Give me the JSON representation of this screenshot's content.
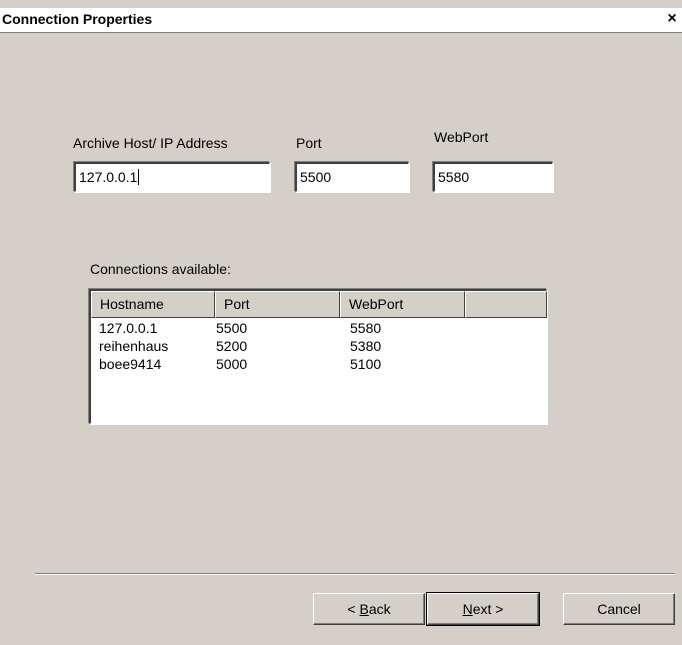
{
  "window": {
    "title": "Connection Properties",
    "close_glyph": "×",
    "close_icon": "close-icon"
  },
  "fields": {
    "host_label": "Archive Host/ IP Address",
    "host_value": "127.0.0.1",
    "port_label": "Port",
    "port_value": "5500",
    "webport_label": "WebPort",
    "webport_value": "5580"
  },
  "connections": {
    "label": "Connections available:",
    "columns": [
      "Hostname",
      "Port",
      "WebPort",
      ""
    ],
    "rows": [
      [
        "127.0.0.1",
        "5500",
        "5580"
      ],
      [
        "reihenhaus",
        "5200",
        "5380"
      ],
      [
        "boee9414",
        "5000",
        "5100"
      ]
    ]
  },
  "buttons": {
    "back_prefix": "< ",
    "back_mnemonic": "B",
    "back_rest": "ack",
    "next_mnemonic": "N",
    "next_rest": "ext >",
    "cancel": "Cancel"
  }
}
